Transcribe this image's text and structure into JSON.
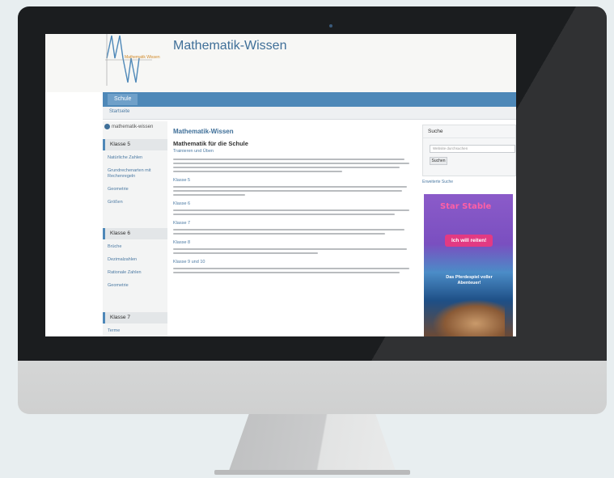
{
  "site": {
    "title": "Mathematik-Wissen",
    "logo_text": "Mathematik Wissen"
  },
  "nav": {
    "home_label": "Schule"
  },
  "breadcrumb": "Startseite",
  "sidebar": {
    "mini_logo": "mathematik-wissen",
    "groups": [
      {
        "title": "Klasse 5",
        "items": [
          "Natürliche Zahlen",
          "Grundrechenarten mit Rechenregeln",
          "Geometrie",
          "Größen"
        ]
      },
      {
        "title": "Klasse 6",
        "items": [
          "Brüche",
          "Dezimalzahlen",
          "Rationale Zahlen",
          "Geometrie"
        ]
      },
      {
        "title": "Klasse 7",
        "items": [
          "Terme"
        ]
      }
    ]
  },
  "main": {
    "page_title": "Mathematik-Wissen",
    "heading": "Mathematik für die Schule",
    "subheading": "Trainieren und Üben",
    "links": [
      "Klasse 5",
      "Klasse 6",
      "Klasse 7",
      "Klasse 8",
      "Klasse 9 und 10"
    ]
  },
  "search": {
    "heading": "Suche",
    "placeholder": "Website durchsuchen",
    "button": "Suchen",
    "advanced": "Erweiterte Suche"
  },
  "ad": {
    "brand": "Star Stable",
    "cta": "Ich will reiten!",
    "tagline": "Das Pferdespiel voller Abenteuer!"
  },
  "colors": {
    "accent": "#4e88b8",
    "title": "#3f6f98",
    "link": "#4c7aa3",
    "ad_pink": "#e23a83"
  }
}
